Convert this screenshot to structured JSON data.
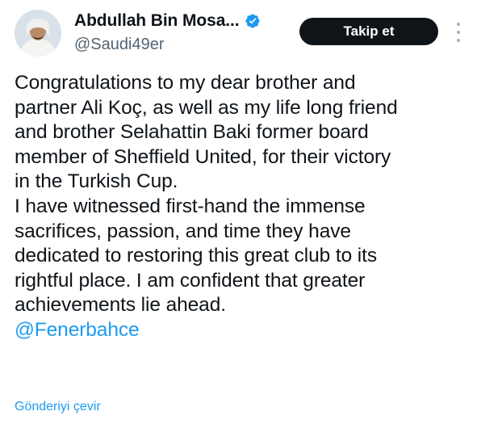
{
  "user": {
    "display_name": "Abdullah Bin Mosa...",
    "handle": "@Saudi49er",
    "verified_icon": "verified-badge-icon"
  },
  "actions": {
    "follow_label": "Takip et",
    "more_icon": "more-options-icon"
  },
  "tweet": {
    "lines": [
      "Congratulations to my dear brother and",
      "partner Ali Koç, as well as my life long friend",
      "and brother Selahattin Baki former board",
      "member of Sheffield United, for their victory",
      "in the Turkish Cup.",
      "I have witnessed first-hand the immense",
      "sacrifices, passion, and time they have",
      "dedicated to restoring this great club to its",
      "rightful place. I am confident that greater",
      "achievements lie ahead."
    ],
    "mention": "@Fenerbahce"
  },
  "translate_label": "Gönderiyi çevir",
  "colors": {
    "accent": "#1d9bf0",
    "text": "#0f1419",
    "muted": "#536471",
    "button_bg": "#0f1419"
  }
}
